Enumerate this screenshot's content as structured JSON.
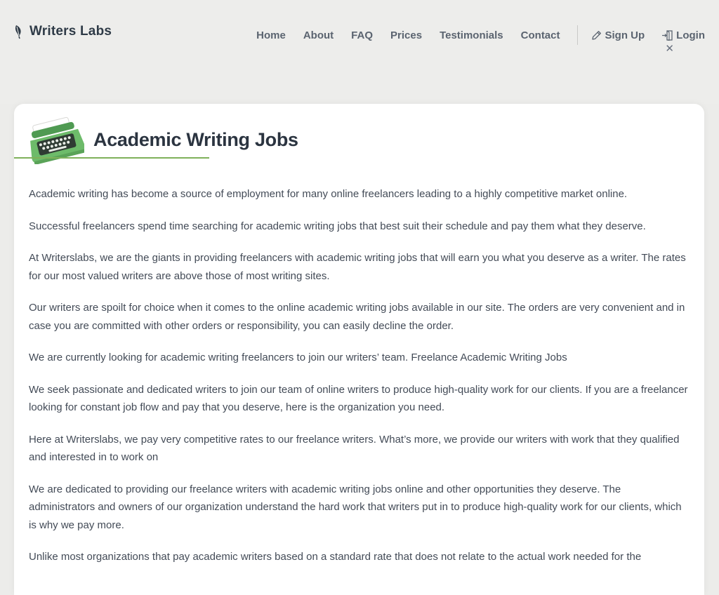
{
  "brand": {
    "name": "Writers Labs"
  },
  "nav": {
    "links": [
      "Home",
      "About",
      "FAQ",
      "Prices",
      "Testimonials",
      "Contact"
    ],
    "signup_label": "Sign Up",
    "login_label": "Login",
    "close_symbol": "✕"
  },
  "page": {
    "title": "Academic Writing Jobs",
    "paragraphs": [
      "Academic writing has become a source of employment for many online freelancers leading to a highly competitive market online.",
      "Successful freelancers spend time searching for academic writing jobs that best suit their schedule and pay them what they deserve.",
      "At Writerslabs, we are the giants in providing freelancers with academic writing jobs that will earn you what you deserve as a writer. The rates for our most valued writers are above those of most writing sites.",
      "Our writers are spoilt for choice when it comes to the online academic writing jobs available in our site. The orders are very convenient and in case you are committed with other orders or responsibility, you can easily decline the order.",
      "We are currently looking for academic writing freelancers to join our writers’ team. Freelance Academic Writing Jobs",
      "We seek passionate and dedicated writers to join our team of online writers to produce high-quality work for our clients. If you are a freelancer looking for constant job flow and pay that you deserve, here is the organization you need.",
      "Here at Writerslabs, we pay very competitive rates to our freelance writers. What’s more, we provide our writers with work that they qualified and interested in to work on",
      "We are dedicated to providing our freelance writers with academic writing jobs online and other opportunities they deserve. The administrators and owners of our organization understand the hard work that writers put in to produce high-quality work for our clients, which is why we pay more.",
      "Unlike most organizations that pay academic writers based on a standard rate that does not relate to the actual work needed for the"
    ]
  },
  "colors": {
    "accent_green": "#7fb15a",
    "typewriter_green": "#6dbb6a",
    "text": "#434b57",
    "nav_text": "#5b6470",
    "background": "#ededeb"
  },
  "icons": {
    "brand": "quill-pen-icon",
    "signup": "pencil-icon",
    "login": "door-enter-icon",
    "close": "close-icon",
    "hero": "typewriter-icon"
  }
}
